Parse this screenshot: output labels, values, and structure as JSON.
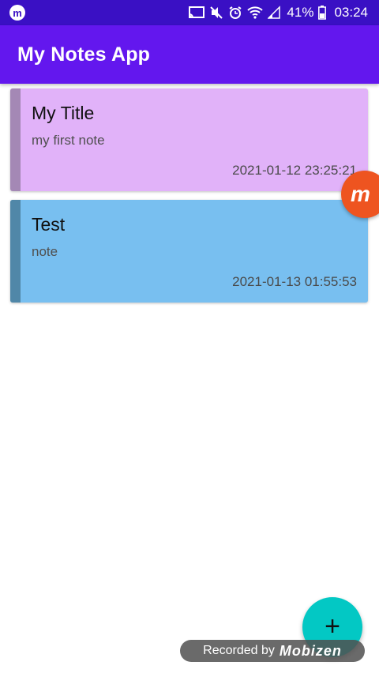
{
  "status_bar": {
    "app_icon": "mobizen-icon",
    "icons": [
      "cast-icon",
      "mute-icon",
      "alarm-icon",
      "wifi-icon",
      "signal-icon",
      "battery-icon"
    ],
    "battery_text": "41%",
    "time": "03:24"
  },
  "app_bar": {
    "title": "My Notes App",
    "color": "#6317ee"
  },
  "notes": [
    {
      "title": "My Title",
      "body": "my first note",
      "date": "2021-01-12 23:25:21",
      "card_color": "#e1b2f9",
      "stripe_color": "#a488b5"
    },
    {
      "title": "Test",
      "body": "note",
      "date": "2021-01-13 01:55:53",
      "card_color": "#78bff0",
      "stripe_color": "#5087a8"
    }
  ],
  "fab": {
    "icon": "plus-icon",
    "symbol": "+",
    "color": "#03c8c4"
  },
  "overlay": {
    "bubble_letter": "m",
    "watermark_prefix": "Recorded by",
    "watermark_brand": "Mobizen"
  }
}
